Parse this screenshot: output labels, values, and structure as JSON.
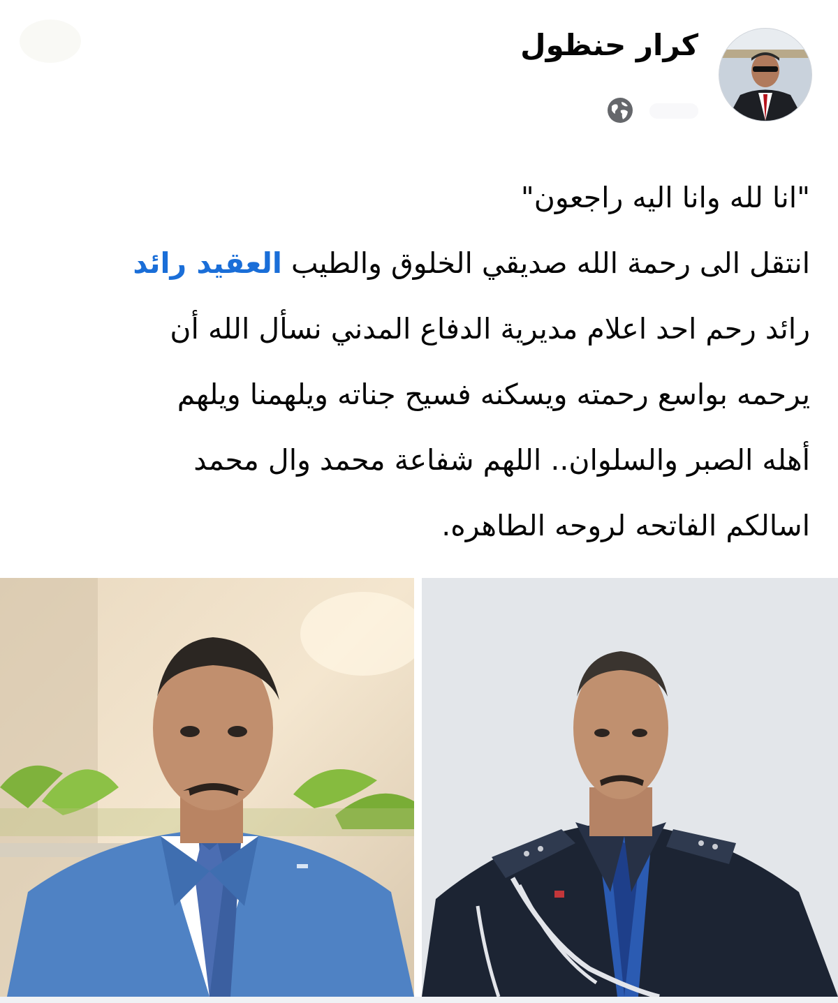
{
  "author": {
    "name": "كرار حنظول",
    "avatar_icon": "profile-photo",
    "privacy_icon": "globe-icon"
  },
  "post": {
    "lines": [
      {
        "text": "\"انا لله وانا اليه راجعون\""
      },
      {
        "text": "انتقل الى رحمة الله صديقي الخلوق والطيب ",
        "mention": "العقيد رائد"
      },
      {
        "text": "رائد رحم احد اعلام مديرية الدفاع المدني نسأل الله أن"
      },
      {
        "text": "يرحمه بواسع رحمته ويسكنه فسيح جناته ويلهمنا ويلهم"
      },
      {
        "text": "أهله الصبر والسلوان.. اللهم شفاعة محمد وال محمد"
      },
      {
        "text": "اسالكم الفاتحه لروحه الطاهره."
      }
    ]
  },
  "photos": [
    {
      "name": "photo-man-blue-suit",
      "kind": "portrait"
    },
    {
      "name": "photo-officer-uniform",
      "kind": "portrait"
    }
  ],
  "colors": {
    "mention": "#1a6ed8",
    "text": "#050505",
    "suit": "#4f82c4",
    "uniform": "#1c2433"
  }
}
